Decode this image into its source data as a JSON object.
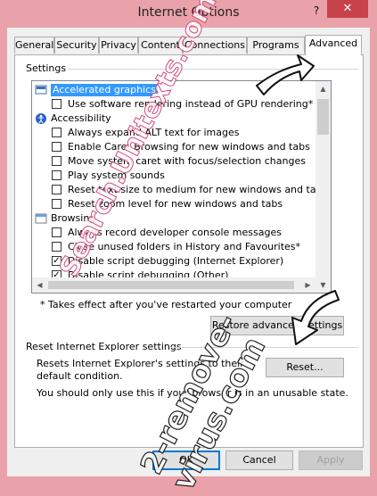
{
  "window": {
    "title": "Internet Options",
    "help_glyph": "?",
    "close_glyph": "✕"
  },
  "tabs": [
    {
      "label": "General"
    },
    {
      "label": "Security"
    },
    {
      "label": "Privacy"
    },
    {
      "label": "Content"
    },
    {
      "label": "Connections"
    },
    {
      "label": "Programs"
    },
    {
      "label": "Advanced"
    }
  ],
  "settings": {
    "group_label": "Settings",
    "items": [
      {
        "kind": "category",
        "label": "Accelerated graphics",
        "icon": "monitor-icon",
        "selected": true
      },
      {
        "kind": "checkbox",
        "label": "Use software rendering instead of GPU rendering*",
        "checked": false
      },
      {
        "kind": "category",
        "label": "Accessibility",
        "icon": "accessibility-icon"
      },
      {
        "kind": "checkbox",
        "label": "Always expand ALT text for images",
        "checked": false
      },
      {
        "kind": "checkbox",
        "label": "Enable Caret Browsing for new windows and tabs",
        "checked": false
      },
      {
        "kind": "checkbox",
        "label": "Move system caret with focus/selection changes",
        "checked": false
      },
      {
        "kind": "checkbox",
        "label": "Play system sounds",
        "checked": false
      },
      {
        "kind": "checkbox",
        "label": "Reset text size to medium for new windows and tabs",
        "checked": false
      },
      {
        "kind": "checkbox",
        "label": "Reset zoom level for new windows and tabs",
        "checked": false
      },
      {
        "kind": "category",
        "label": "Browsing",
        "icon": "browsing-icon"
      },
      {
        "kind": "checkbox",
        "label": "Always record developer console messages",
        "checked": false
      },
      {
        "kind": "checkbox",
        "label": "Close unused folders in History and Favourites*",
        "checked": false
      },
      {
        "kind": "checkbox",
        "label": "Disable script debugging (Internet Explorer)",
        "checked": true
      },
      {
        "kind": "checkbox",
        "label": "Disable script debugging (Other)",
        "checked": true
      }
    ],
    "footnote": "* Takes effect after you've restarted your computer",
    "restore_button": "Restore advanced settings"
  },
  "reset": {
    "group_label": "Reset Internet Explorer settings",
    "description": "Resets Internet Explorer's settings to their default condition.",
    "reset_button": "Reset...",
    "warning": "You should only use this if your browser is in an unusable state."
  },
  "footer": {
    "ok": "OK",
    "cancel": "Cancel",
    "apply": "Apply"
  },
  "watermark": {
    "line1": "Search.Unitexts.com",
    "line2": "2-remove-virus.com"
  },
  "colors": {
    "frame": "#e9a2a9",
    "close": "#c7424b",
    "selection": "#3399ff"
  }
}
